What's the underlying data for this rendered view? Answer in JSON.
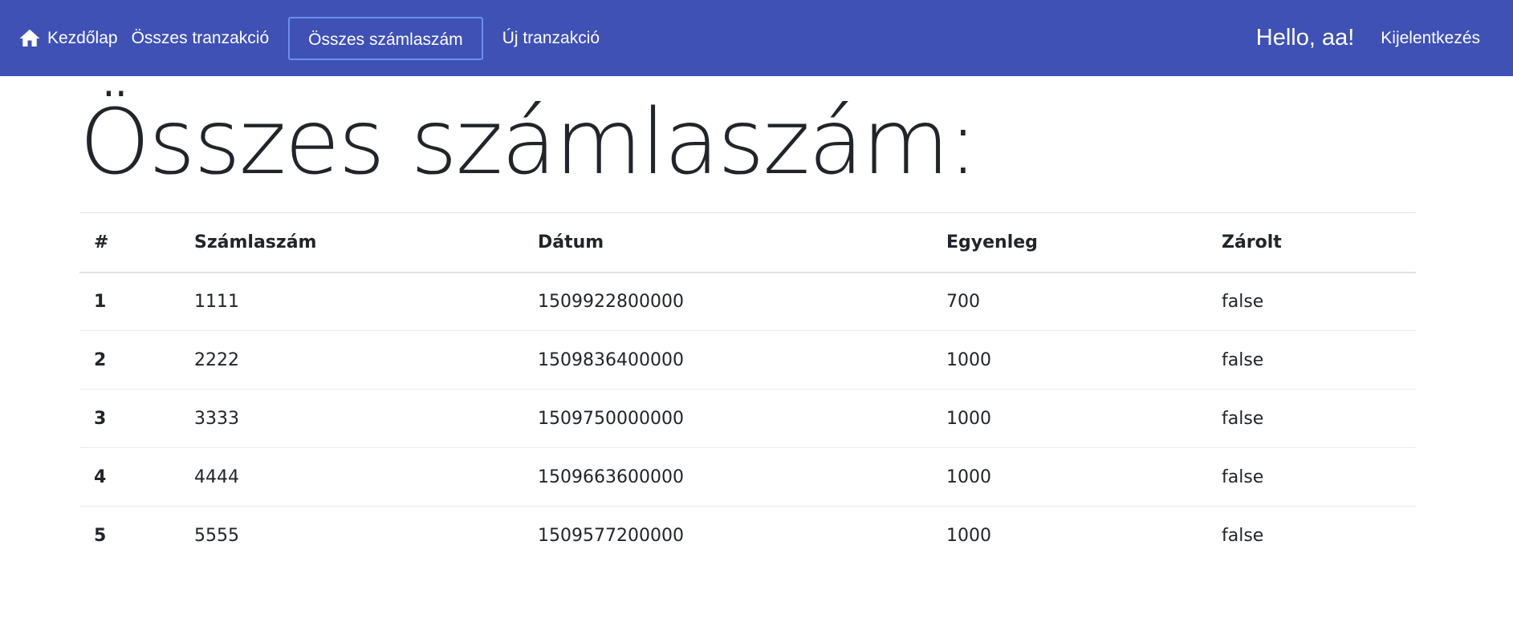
{
  "navbar": {
    "home_label": "Kezdőlap",
    "links": [
      "Összes tranzakció",
      "Összes számlaszám",
      "Új tranzakció"
    ],
    "active_index": 1,
    "greeting": "Hello, aa!",
    "logout_label": "Kijelentkezés",
    "bg_color": "#3f51b5",
    "home_icon": "home-icon"
  },
  "page": {
    "title": "Összes számlaszám:"
  },
  "table": {
    "headers": [
      "#",
      "Számlaszám",
      "Dátum",
      "Egyenleg",
      "Zárolt"
    ],
    "rows": [
      [
        "1",
        "1111",
        "1509922800000",
        "700",
        "false"
      ],
      [
        "2",
        "2222",
        "1509836400000",
        "1000",
        "false"
      ],
      [
        "3",
        "3333",
        "1509750000000",
        "1000",
        "false"
      ],
      [
        "4",
        "4444",
        "1509663600000",
        "1000",
        "false"
      ],
      [
        "5",
        "5555",
        "1509577200000",
        "1000",
        "false"
      ]
    ]
  }
}
